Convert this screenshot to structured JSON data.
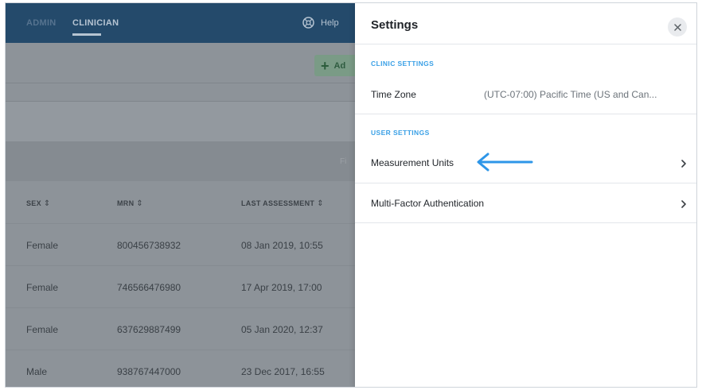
{
  "nav": {
    "admin": "ADMIN",
    "clinician": "CLINICIAN",
    "help": "Help"
  },
  "toolbar": {
    "add_label": "Ad"
  },
  "filter": {
    "hint": "Fi"
  },
  "table": {
    "headers": [
      "SEX",
      "MRN",
      "LAST ASSESSMENT"
    ],
    "rows": [
      [
        "Female",
        "800456738932",
        "08 Jan 2019, 10:55"
      ],
      [
        "Female",
        "746566476980",
        "17 Apr 2019, 17:00"
      ],
      [
        "Female",
        "637629887499",
        "05 Jan 2020, 12:37"
      ],
      [
        "Male",
        "938767447000",
        "23 Dec 2017, 16:55"
      ]
    ]
  },
  "settings": {
    "title": "Settings",
    "clinic_section": "CLINIC SETTINGS",
    "time_zone_label": "Time Zone",
    "time_zone_value": "(UTC-07:00) Pacific Time (US and Can...",
    "user_section": "USER SETTINGS",
    "measurement_units_label": "Measurement Units",
    "mfa_label": "Multi-Factor Authentication"
  },
  "colors": {
    "topbar": "#244a6b",
    "accent_blue": "#3aa0e6",
    "overlay_gray": "#8d9399",
    "annotation_arrow": "#2e96e8"
  },
  "icons": [
    "help-globe-icon",
    "plus-icon",
    "sort-icon",
    "close-icon",
    "chevron-right-icon",
    "annotation-arrow-icon"
  ]
}
